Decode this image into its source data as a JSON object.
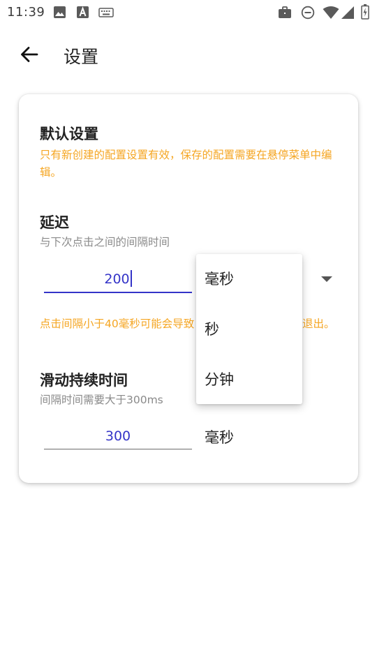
{
  "status_bar": {
    "time": "11:39",
    "left_icons": [
      "image-icon",
      "text-a-icon",
      "keyboard-icon"
    ],
    "right_icons": [
      "briefcase-icon",
      "dnd-icon",
      "wifi-icon",
      "signal-icon",
      "battery-icon"
    ]
  },
  "app_bar": {
    "back_icon": "arrow-back-icon",
    "title": "设置"
  },
  "default_settings": {
    "title": "默认设置",
    "warning": "只有新创建的配置设置有效，保存的配置需要在悬停菜单中编辑。"
  },
  "delay": {
    "title": "延迟",
    "hint": "与下次点击之间的间隔时间",
    "value": "200",
    "warning": "点击间隔小于40毫秒可能会导致",
    "warning_tail": "退出。"
  },
  "swipe_duration": {
    "title": "滑动持续时间",
    "hint": "间隔时间需要大于300ms",
    "value": "300",
    "unit": "毫秒"
  },
  "unit_menu": {
    "options": [
      "毫秒",
      "秒",
      "分钟"
    ]
  },
  "colors": {
    "accent": "#3434c8",
    "warning": "#f5a623",
    "hint": "#8a8a8a"
  }
}
